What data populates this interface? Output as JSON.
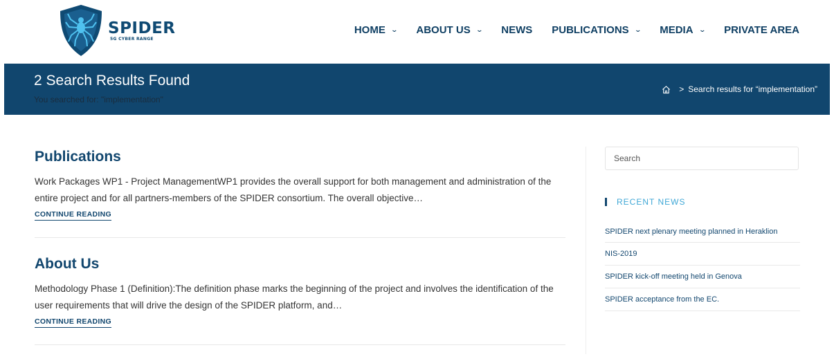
{
  "brand": {
    "title": "SPIDER",
    "subtitle": "5G CYBER RANGE",
    "primary": "#11466e",
    "accent": "#3fa7d6",
    "logo_fill": "#0f4a73"
  },
  "nav": {
    "items": [
      {
        "label": "HOME",
        "dropdown": true
      },
      {
        "label": "ABOUT US",
        "dropdown": true
      },
      {
        "label": "NEWS",
        "dropdown": false
      },
      {
        "label": "PUBLICATIONS",
        "dropdown": true
      },
      {
        "label": "MEDIA",
        "dropdown": true
      },
      {
        "label": "PRIVATE AREA",
        "dropdown": false
      }
    ],
    "chevron": "⌄"
  },
  "banner": {
    "title": "2 Search Results Found",
    "subtitle": "You searched for: \"implementation\"",
    "breadcrumb_sep": ">",
    "breadcrumb_current": "Search results for “implementation”"
  },
  "results": [
    {
      "title": "Publications",
      "excerpt": "Work Packages WP1 - Project ManagementWP1 provides the overall support for both management and administration of the entire project and for all partners-members of the SPIDER consortium. The overall objective…",
      "more": "CONTINUE READING"
    },
    {
      "title": "About Us",
      "excerpt": "Methodology Phase 1 (Definition):The definition phase marks the beginning of the project and involves the identification of the user requirements that will drive the design of the SPIDER platform, and…",
      "more": "CONTINUE READING"
    }
  ],
  "sidebar": {
    "search_placeholder": "Search",
    "widget_title": "RECENT NEWS",
    "news": [
      "SPIDER next plenary meeting planned in Heraklion",
      "NIS-2019",
      "SPIDER kick-off meeting held in Genova",
      "SPIDER acceptance from the EC."
    ]
  }
}
